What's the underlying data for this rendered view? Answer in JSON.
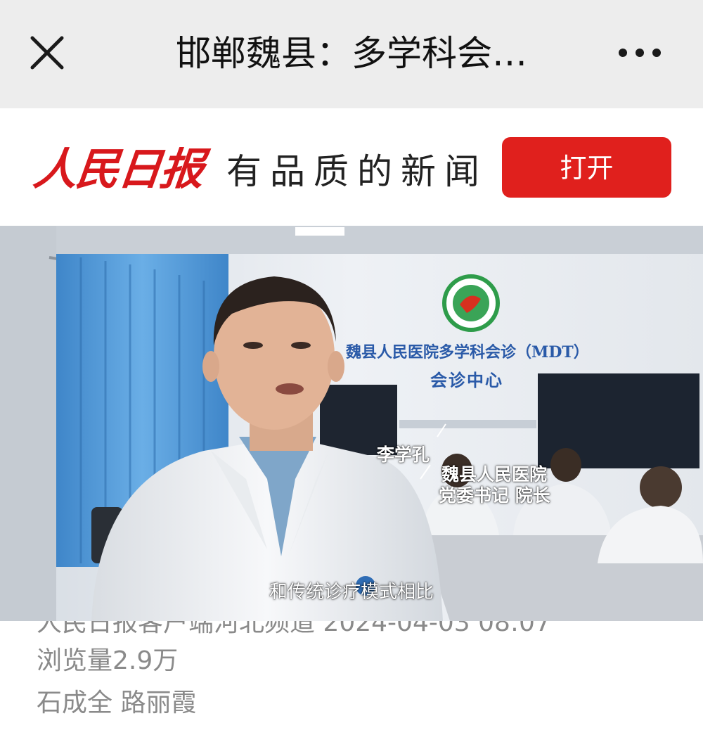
{
  "nav": {
    "title": "邯郸魏县：多学科会…",
    "close_icon": "close-icon",
    "more_icon": "more-icon"
  },
  "banner": {
    "logo_text": "人民日报",
    "slogan": "有品质的新闻",
    "open_label": "打开",
    "brand_color": "#e0201d"
  },
  "video": {
    "wall_sign_line1": "魏县人民医院多学科会诊（MDT）",
    "wall_sign_line2": "会诊中心",
    "speaker_name": "李学孔",
    "speaker_org": "魏县人民医院",
    "speaker_role": "党委书记 院长",
    "subtitle": "和传统诊疗模式相比"
  },
  "meta": {
    "source": "人民日报客户端河北频道 2024-04-03 08:07",
    "views": "浏览量2.9万",
    "authors": "石成全 路丽霞"
  }
}
